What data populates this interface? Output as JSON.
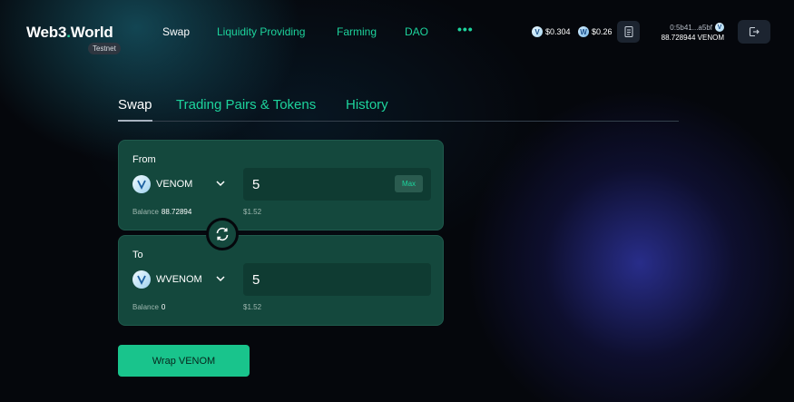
{
  "brand": {
    "name_main": "Web3",
    "name_accent": ".",
    "name_tail": "World",
    "badge": "Testnet"
  },
  "nav": {
    "swap": "Swap",
    "liquidity": "Liquidity Providing",
    "farming": "Farming",
    "dao": "DAO",
    "more": "•••"
  },
  "prices": [
    {
      "symbol": "V",
      "value": "$0.304"
    },
    {
      "symbol": "W",
      "value": "$0.26"
    }
  ],
  "wallet": {
    "address": "0:5b41...a5bf",
    "balance": "88.728944 VENOM"
  },
  "tabs": {
    "swap": "Swap",
    "pairs": "Trading Pairs & Tokens",
    "history": "History"
  },
  "from": {
    "title": "From",
    "token": "VENOM",
    "amount": "5",
    "max_label": "Max",
    "balance_label": "Balance",
    "balance_value": "88.72894",
    "usd": "$1.52"
  },
  "to": {
    "title": "To",
    "token": "WVENOM",
    "amount": "5",
    "balance_label": "Balance",
    "balance_value": "0",
    "usd": "$1.52"
  },
  "action": {
    "label": "Wrap VENOM"
  },
  "colors": {
    "accent": "#1dd39c",
    "card": "#14483d",
    "button": "#19c48c",
    "background": "#05070c"
  },
  "icons": {
    "wallet_token": "venom-coin-icon",
    "receipt": "receipt-icon",
    "logout": "logout-icon",
    "swap_direction": "swap-arrows-icon",
    "dropdown": "chevron-down-icon"
  }
}
